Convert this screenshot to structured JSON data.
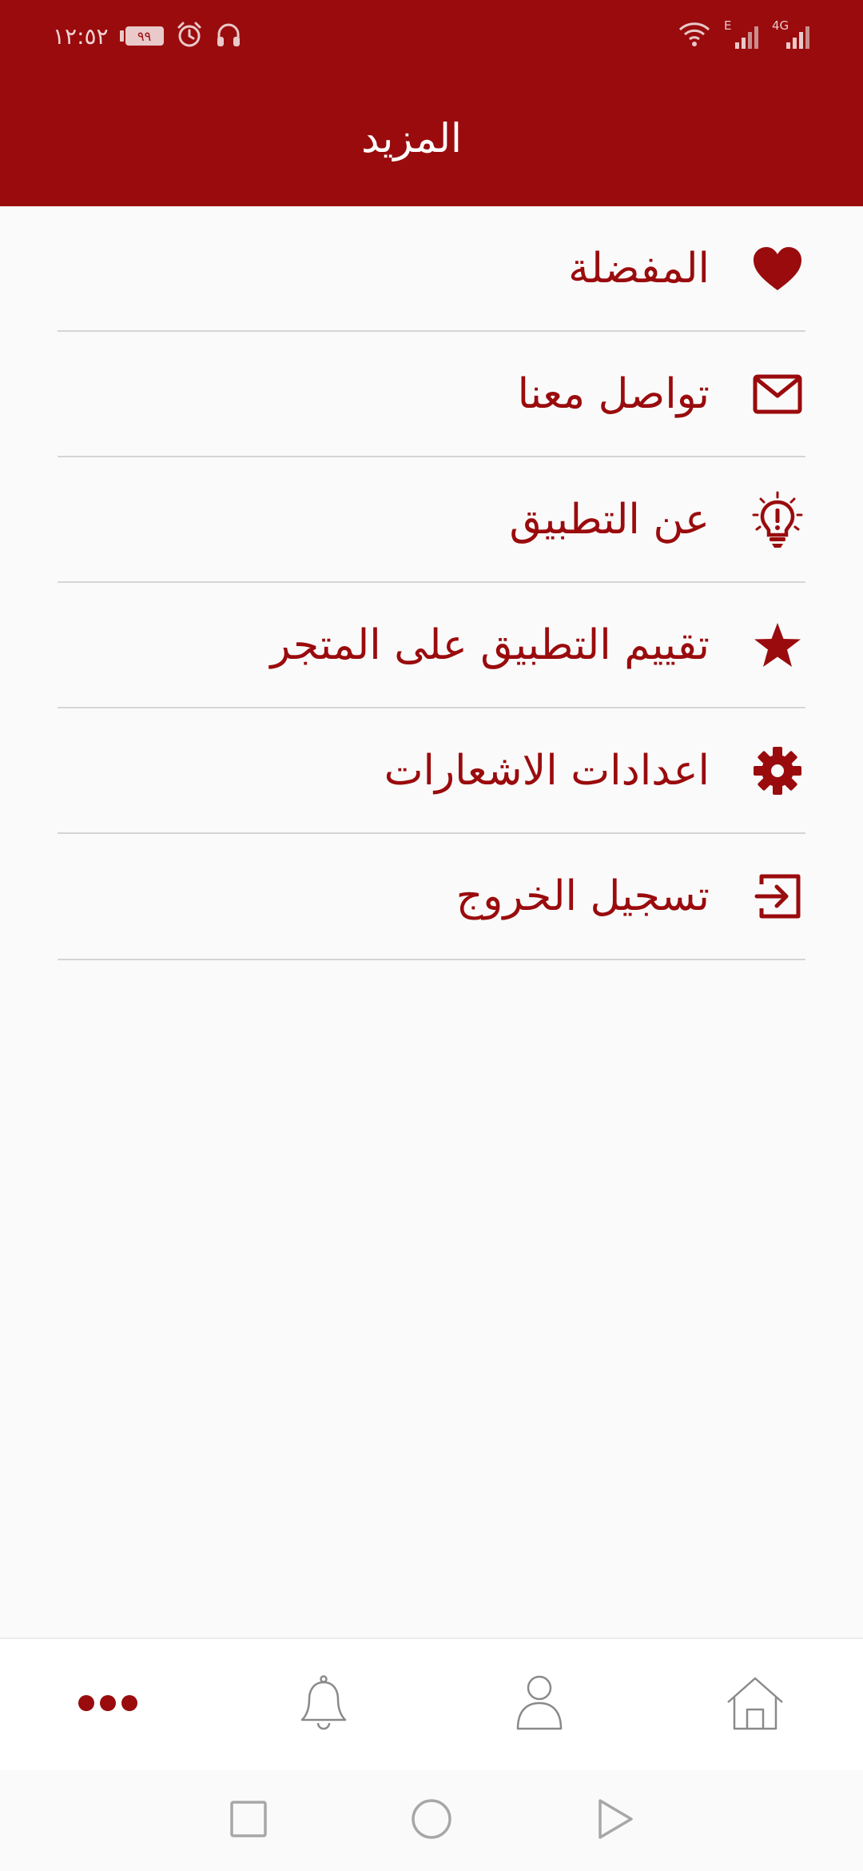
{
  "status_bar": {
    "time": "١٢:٥٢",
    "battery_level": "٩٩",
    "network_type": "4G",
    "secondary_network": "E"
  },
  "header": {
    "title": "المزيد"
  },
  "menu": {
    "items": [
      {
        "label": "المفضلة",
        "icon": "heart-icon"
      },
      {
        "label": "تواصل معنا",
        "icon": "envelope-icon"
      },
      {
        "label": "عن التطبيق",
        "icon": "lightbulb-icon"
      },
      {
        "label": "تقييم التطبيق على المتجر",
        "icon": "star-icon"
      },
      {
        "label": "اعدادات الاشعارات",
        "icon": "gear-icon"
      },
      {
        "label": "تسجيل الخروج",
        "icon": "logout-icon"
      }
    ]
  },
  "bottom_nav": {
    "items": [
      {
        "icon": "more-dots-icon",
        "active": true
      },
      {
        "icon": "bell-icon",
        "active": false
      },
      {
        "icon": "user-icon",
        "active": false
      },
      {
        "icon": "home-icon",
        "active": false
      }
    ]
  },
  "system_nav": {
    "items": [
      "recents-square-icon",
      "home-circle-icon",
      "back-triangle-icon"
    ]
  },
  "colors": {
    "primary": "#9a0b0d",
    "background": "#fafafa",
    "divider": "#d5d5d5",
    "inactive_icon": "#8a8a8a"
  }
}
